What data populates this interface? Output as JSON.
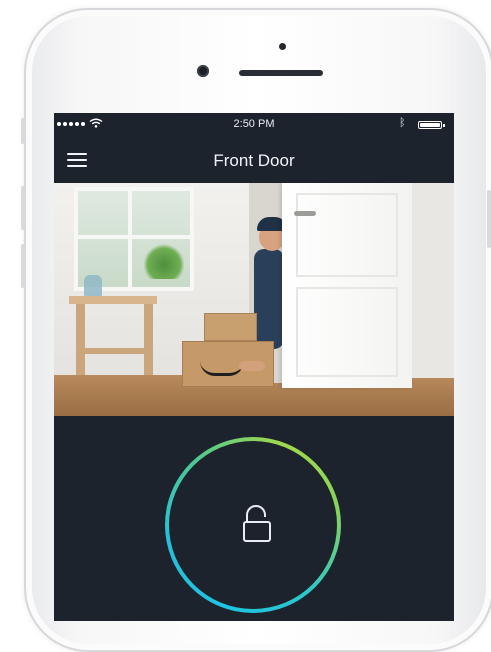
{
  "status_bar": {
    "time": "2:50 PM"
  },
  "header": {
    "title": "Front Door"
  },
  "camera_feed": {
    "scene": "front-door-camera-view"
  },
  "lock_control": {
    "state": "unlocked",
    "icon": "open-padlock-icon",
    "ring_colors": [
      "#1ec4e2",
      "#a2d84b"
    ]
  },
  "colors": {
    "screen_background": "#1d232d",
    "text": "#f1f4f8"
  }
}
